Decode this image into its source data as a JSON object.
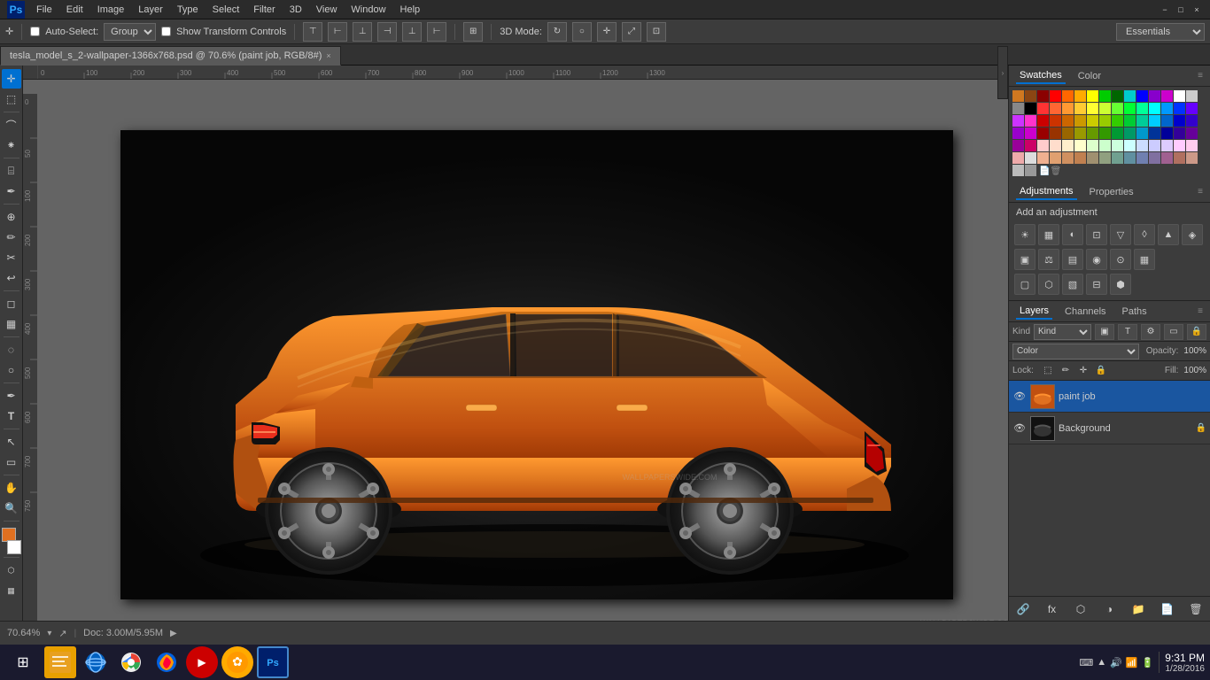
{
  "titlebar": {
    "ps_logo": "Ps",
    "menu_items": [
      "File",
      "Edit",
      "Image",
      "Layer",
      "Type",
      "Select",
      "Filter",
      "3D",
      "View",
      "Window",
      "Help"
    ],
    "min_label": "−",
    "max_label": "□",
    "close_label": "×"
  },
  "options_bar": {
    "auto_select_label": "Auto-Select:",
    "group_value": "Group",
    "show_transform_label": "Show Transform Controls",
    "3d_mode_label": "3D Mode:",
    "essentials_value": "Essentials"
  },
  "tab": {
    "filename": "tesla_model_s_2-wallpaper-1366x768.psd @ 70.6% (paint job, RGB/8#)",
    "close_label": "×"
  },
  "swatches_panel": {
    "tab1": "Swatches",
    "tab2": "Color",
    "colors": [
      "#d07820",
      "#8b4513",
      "#8b0000",
      "#ff0000",
      "#ff6600",
      "#ffaa00",
      "#ffff00",
      "#00cc00",
      "#006600",
      "#00cccc",
      "#0000ff",
      "#8800cc",
      "#cc00cc",
      "#ffffff",
      "#000000",
      "#ff3333",
      "#ff6633",
      "#ff9933",
      "#ffcc33",
      "#ffff33",
      "#ccff33",
      "#66ff33",
      "#00ff33",
      "#00ff99",
      "#00ffff",
      "#0099ff",
      "#0033ff",
      "#6600ff",
      "#cc33ff",
      "#ff33cc",
      "#cc0000",
      "#cc3300",
      "#cc6600",
      "#cc9900",
      "#cccc00",
      "#99cc00",
      "#33cc00",
      "#00cc33",
      "#00cc99",
      "#00ccff",
      "#0066cc",
      "#0000cc",
      "#3300cc",
      "#9900cc",
      "#cc00cc",
      "#990000",
      "#993300",
      "#996600",
      "#999900",
      "#669900",
      "#339900",
      "#009933",
      "#009966",
      "#0099cc",
      "#003399",
      "#000099",
      "#330099",
      "#660099",
      "#990099",
      "#cc0066",
      "#660000",
      "#663300",
      "#666600",
      "#336600",
      "#006600",
      "#006633",
      "#006666",
      "#003366",
      "#000066",
      "#330066",
      "#660066",
      "#990033",
      "#cc6699",
      "#ffcccc",
      "#ffffcc",
      "#ccffcc",
      "#ccffff",
      "#ccccff",
      "#ffccff",
      "#ffaaaa",
      "#ffddaa",
      "#ffffaa",
      "#aaffaa",
      "#aaffff",
      "#aaaaff",
      "#ffaaff",
      "#dddddd",
      "#bbbbbb",
      "#999999",
      "#777777",
      "#555555",
      "#333333",
      "#111111",
      "#ff8080",
      "#ff80ff",
      "#8080ff",
      "#80ffff",
      "#80ff80",
      "#ffff80",
      "#ff8000",
      "#80ff00",
      "#00ff80",
      "#0080ff",
      "#8000ff",
      "#ff0080",
      "#e06050",
      "#e08050",
      "#e0b050",
      "#a0c050",
      "#50c080",
      "#50c0c0",
      "#5080c0",
      "#8050c0",
      "#c050c0",
      "#c05080"
    ]
  },
  "adjustments_panel": {
    "tab1": "Adjustments",
    "tab2": "Properties",
    "add_text": "Add an adjustment",
    "icons_row1": [
      "☀",
      "▦",
      "◐",
      "⊡",
      "▽",
      "◊",
      "▲",
      "◈"
    ],
    "icons_row2": [
      "▣",
      "⚖",
      "▤",
      "◉",
      "⊙",
      "▦"
    ],
    "icons_row3": [
      "▢",
      "⬡",
      "▧",
      "⊟",
      "⬢"
    ]
  },
  "layers_panel": {
    "tab1": "Layers",
    "tab2": "Channels",
    "tab3": "Paths",
    "kind_label": "Kind",
    "opacity_label": "Opacity:",
    "opacity_value": "100%",
    "fill_label": "Fill:",
    "fill_value": "100%",
    "lock_label": "Lock:",
    "layers": [
      {
        "name": "paint job",
        "visible": true,
        "selected": true,
        "thumb_bg": "#e07020",
        "has_lock": false
      },
      {
        "name": "Background",
        "visible": true,
        "selected": false,
        "thumb_bg": "#333",
        "has_lock": true
      }
    ],
    "bottom_icons": [
      "fx",
      "⊕",
      "▢",
      "⊞",
      "🗑"
    ]
  },
  "status_bar": {
    "zoom": "70.64%",
    "doc_info": "Doc: 3.00M/5.95M"
  },
  "taskbar": {
    "start_icon": "⊞",
    "icons": [
      "📁",
      "🌐",
      "🌐",
      "🦊",
      "🔴",
      "✿",
      "Ps"
    ],
    "icon_colors": [
      "#f0c040",
      "#0060c0",
      "#2a9fd6",
      "#ff6600",
      "#cc0000",
      "#ffaa00",
      "#31a8ff"
    ],
    "time": "9:31 PM",
    "date": "1/28/2016",
    "sys_icons": [
      "⌨",
      "↑",
      "🔊",
      "📶",
      "🔋"
    ]
  }
}
